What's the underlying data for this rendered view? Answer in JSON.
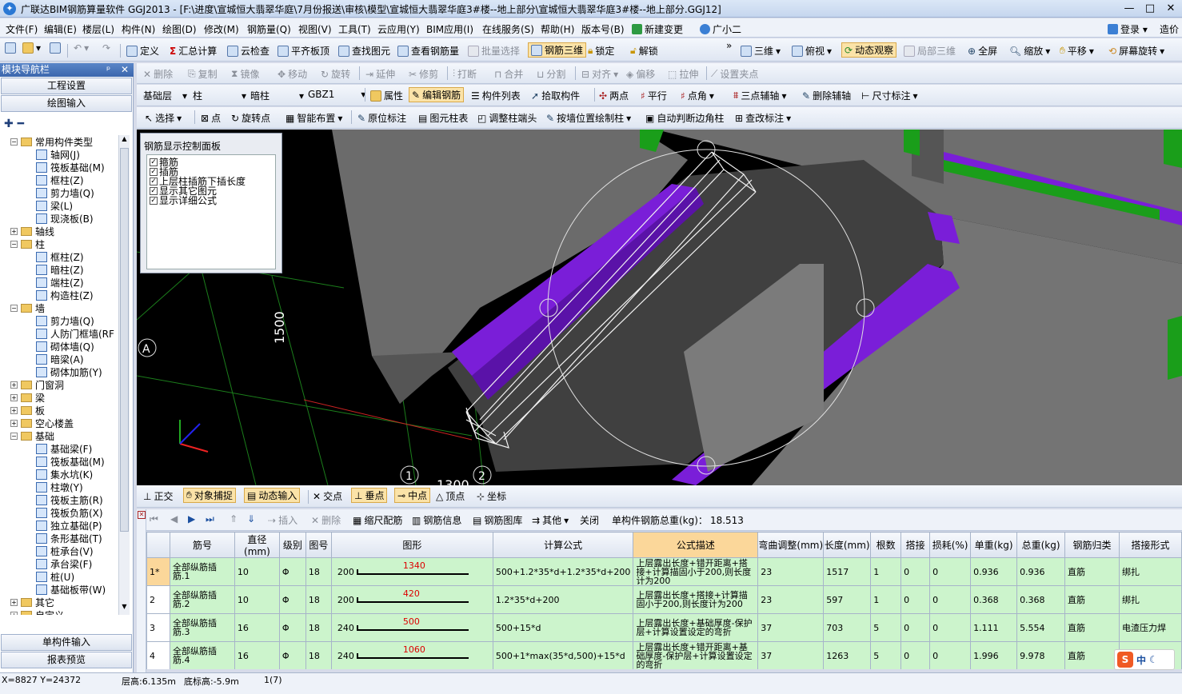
{
  "window": {
    "title": "广联达BIM钢筋算量软件 GGJ2013 - [F:\\进度\\宣城恒大翡翠华庭\\7月份报送\\审核\\模型\\宣城恒大翡翠华庭3#楼--地上部分\\宣城恒大翡翠华庭3#楼--地上部分.GGJ12]",
    "minimize": "—",
    "maximize": "□",
    "close": "✕"
  },
  "menu": [
    "文件(F)",
    "编辑(E)",
    "楼层(L)",
    "构件(N)",
    "绘图(D)",
    "修改(M)",
    "钢筋量(Q)",
    "视图(V)",
    "工具(T)",
    "云应用(Y)",
    "BIM应用(I)",
    "在线服务(S)",
    "帮助(H)",
    "版本号(B)",
    "新建变更",
    "广小二"
  ],
  "menu_right": {
    "login": "登录",
    "price": "造价"
  },
  "toolbar1": [
    "定义",
    "汇总计算",
    "云检查",
    "平齐板顶",
    "查找图元",
    "查看钢筋量",
    "批量选择",
    "钢筋三维",
    "锁定",
    "解锁",
    "三维",
    "俯视",
    "动态观察",
    "局部三维",
    "全屏",
    "缩放",
    "平移",
    "屏幕旋转"
  ],
  "toolbar2": [
    "删除",
    "复制",
    "镜像",
    "移动",
    "旋转",
    "延伸",
    "修剪",
    "打断",
    "合并",
    "分割",
    "对齐",
    "偏移",
    "拉伸",
    "设置夹点"
  ],
  "toolbar3": {
    "floor": "基础层",
    "type": "柱",
    "sub": "暗柱",
    "name": "GBZ1",
    "items": [
      "属性",
      "编辑钢筋",
      "构件列表",
      "拾取构件",
      "两点",
      "平行",
      "点角",
      "三点辅轴",
      "删除辅轴",
      "尺寸标注"
    ]
  },
  "toolbar4": [
    "选择",
    "点",
    "旋转点",
    "智能布置",
    "原位标注",
    "图元柱表",
    "调整柱端头",
    "按墙位置绘制柱",
    "自动判断边角柱",
    "查改标注"
  ],
  "nav": {
    "header": "模块导航栏",
    "pin": "ᵖ",
    "close": "✕",
    "project_settings": "工程设置",
    "drawing_input": "绘图输入",
    "tree": [
      {
        "label": "常用构件类型",
        "level": 1,
        "type": "folder",
        "exp": "−"
      },
      {
        "label": "轴网(J)",
        "level": 2,
        "type": "leaf"
      },
      {
        "label": "筏板基础(M)",
        "level": 2,
        "type": "leaf"
      },
      {
        "label": "框柱(Z)",
        "level": 2,
        "type": "leaf"
      },
      {
        "label": "剪力墙(Q)",
        "level": 2,
        "type": "leaf"
      },
      {
        "label": "梁(L)",
        "level": 2,
        "type": "leaf"
      },
      {
        "label": "现浇板(B)",
        "level": 2,
        "type": "leaf"
      },
      {
        "label": "轴线",
        "level": 1,
        "type": "folder",
        "exp": "+"
      },
      {
        "label": "柱",
        "level": 1,
        "type": "folder",
        "exp": "−"
      },
      {
        "label": "框柱(Z)",
        "level": 2,
        "type": "leaf"
      },
      {
        "label": "暗柱(Z)",
        "level": 2,
        "type": "leaf"
      },
      {
        "label": "端柱(Z)",
        "level": 2,
        "type": "leaf"
      },
      {
        "label": "构造柱(Z)",
        "level": 2,
        "type": "leaf"
      },
      {
        "label": "墙",
        "level": 1,
        "type": "folder",
        "exp": "−"
      },
      {
        "label": "剪力墙(Q)",
        "level": 2,
        "type": "leaf"
      },
      {
        "label": "人防门框墙(RF",
        "level": 2,
        "type": "leaf"
      },
      {
        "label": "砌体墙(Q)",
        "level": 2,
        "type": "leaf"
      },
      {
        "label": "暗梁(A)",
        "level": 2,
        "type": "leaf"
      },
      {
        "label": "砌体加筋(Y)",
        "level": 2,
        "type": "leaf"
      },
      {
        "label": "门窗洞",
        "level": 1,
        "type": "folder",
        "exp": "+"
      },
      {
        "label": "梁",
        "level": 1,
        "type": "folder",
        "exp": "+"
      },
      {
        "label": "板",
        "level": 1,
        "type": "folder",
        "exp": "+"
      },
      {
        "label": "空心楼盖",
        "level": 1,
        "type": "folder",
        "exp": "+"
      },
      {
        "label": "基础",
        "level": 1,
        "type": "folder",
        "exp": "−"
      },
      {
        "label": "基础梁(F)",
        "level": 2,
        "type": "leaf"
      },
      {
        "label": "筏板基础(M)",
        "level": 2,
        "type": "leaf"
      },
      {
        "label": "集水坑(K)",
        "level": 2,
        "type": "leaf"
      },
      {
        "label": "柱墩(Y)",
        "level": 2,
        "type": "leaf"
      },
      {
        "label": "筏板主筋(R)",
        "level": 2,
        "type": "leaf"
      },
      {
        "label": "筏板负筋(X)",
        "level": 2,
        "type": "leaf"
      },
      {
        "label": "独立基础(P)",
        "level": 2,
        "type": "leaf"
      },
      {
        "label": "条形基础(T)",
        "level": 2,
        "type": "leaf"
      },
      {
        "label": "桩承台(V)",
        "level": 2,
        "type": "leaf"
      },
      {
        "label": "承台梁(F)",
        "level": 2,
        "type": "leaf"
      },
      {
        "label": "桩(U)",
        "level": 2,
        "type": "leaf"
      },
      {
        "label": "基础板带(W)",
        "level": 2,
        "type": "leaf"
      },
      {
        "label": "其它",
        "level": 1,
        "type": "folder",
        "exp": "+"
      },
      {
        "label": "自定义",
        "level": 1,
        "type": "folder",
        "exp": "+"
      }
    ],
    "single_input": "单构件输入",
    "report_preview": "报表预览"
  },
  "ctrl_panel": {
    "title": "钢筋显示控制面板",
    "options": [
      "箍筋",
      "插筋",
      "上层柱插筋下插长度",
      "显示其它图元",
      "显示详细公式"
    ]
  },
  "viewport": {
    "dim_1500": "1500",
    "dim_1300": "1300",
    "axis_a": "A",
    "axis_1": "1",
    "axis_2": "2"
  },
  "snapbar": [
    "正交",
    "对象捕捉",
    "动态输入",
    "交点",
    "垂点",
    "中点",
    "顶点",
    "坐标"
  ],
  "gridtb": {
    "items": [
      "插入",
      "删除",
      "缩尺配筋",
      "钢筋信息",
      "钢筋图库",
      "其他",
      "关闭"
    ],
    "total_label": "单构件钢筋总重(kg)：",
    "total_value": "18.513"
  },
  "table": {
    "headers": [
      "筋号",
      "直径(mm)",
      "级别",
      "图号",
      "图形",
      "计算公式",
      "公式描述",
      "弯曲调整(mm)",
      "长度(mm)",
      "根数",
      "搭接",
      "损耗(%)",
      "单重(kg)",
      "总重(kg)",
      "钢筋归类",
      "搭接形式"
    ],
    "rows": [
      {
        "rn": "1*",
        "name": "全部纵筋插筋.1",
        "dia": "10",
        "grade": "Φ",
        "fig": "18",
        "left": "200",
        "shape": "1340",
        "formula": "500+1.2*35*d+1.2*35*d+200",
        "desc": "上层露出长度+错开距离+搭接+计算描固小于200,则长度计为200",
        "bend": "23",
        "len": "1517",
        "count": "1",
        "lap": "0",
        "loss": "0",
        "unit": "0.936",
        "total": "0.936",
        "cat": "直筋",
        "lapform": "绑扎"
      },
      {
        "rn": "2",
        "name": "全部纵筋插筋.2",
        "dia": "10",
        "grade": "Φ",
        "fig": "18",
        "left": "200",
        "shape": "420",
        "formula": "1.2*35*d+200",
        "desc": "上层露出长度+搭接+计算描固小于200,则长度计为200",
        "bend": "23",
        "len": "597",
        "count": "1",
        "lap": "0",
        "loss": "0",
        "unit": "0.368",
        "total": "0.368",
        "cat": "直筋",
        "lapform": "绑扎"
      },
      {
        "rn": "3",
        "name": "全部纵筋插筋.3",
        "dia": "16",
        "grade": "Φ",
        "fig": "18",
        "left": "240",
        "shape": "500",
        "formula": "500+15*d",
        "desc": "上层露出长度+基础厚度-保护层+计算设置设定的弯折",
        "bend": "37",
        "len": "703",
        "count": "5",
        "lap": "0",
        "loss": "0",
        "unit": "1.111",
        "total": "5.554",
        "cat": "直筋",
        "lapform": "电渣压力焊"
      },
      {
        "rn": "4",
        "name": "全部纵筋插筋.4",
        "dia": "16",
        "grade": "Φ",
        "fig": "18",
        "left": "240",
        "shape": "1060",
        "formula": "500+1*max(35*d,500)+15*d",
        "desc": "上层露出长度+错开距离+基础厚度-保护层+计算设置设定的弯折",
        "bend": "37",
        "len": "1263",
        "count": "5",
        "lap": "0",
        "loss": "0",
        "unit": "1.996",
        "total": "9.978",
        "cat": "直筋",
        "lapform": "电渣压力焊"
      }
    ]
  },
  "status": {
    "coords": "X=8827  Y=24372",
    "floor_h": "层高:6.135m",
    "base_h": "底标高:-5.9m",
    "sel": "1(7)",
    "ime": "中"
  },
  "colors": {
    "wall_gray": "#6e6e6e",
    "beam_purple": "#7a1ed8",
    "green_bar": "#1a9e1a",
    "row_green": "#ccf4cc",
    "highlight": "#fbd79a"
  }
}
